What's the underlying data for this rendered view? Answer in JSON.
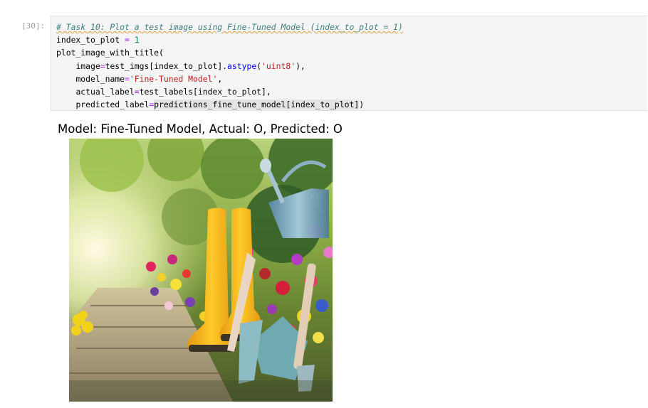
{
  "cell": {
    "prompt": "[30]:",
    "lines": {
      "l1": {
        "comment": "# Task 10: Plot a test image using Fine-Tuned Model (index_to_plot = 1)"
      },
      "l2": {
        "var": "index_to_plot",
        "op": " = ",
        "num": "1"
      },
      "l3": {
        "text": "plot_image_with_title("
      },
      "l4": {
        "indent": "    ",
        "kw": "image",
        "op": "=",
        "p1": "test_imgs[index_to_plot].",
        "meth": "astype",
        "p2": "(",
        "str": "'uint8'",
        "p3": "),"
      },
      "l5": {
        "indent": "    ",
        "kw": "model_name",
        "op": "=",
        "str": "'Fine-Tuned Model'",
        "p": ","
      },
      "l6": {
        "indent": "    ",
        "kw": "actual_label",
        "op": "=",
        "p": "test_labels[index_to_plot],"
      },
      "l7": {
        "indent": "    ",
        "kw": "predicted_label",
        "op": "=",
        "p1": "predictions_fine_tune_model[index_to_plot]",
        "p2": ")"
      }
    }
  },
  "output": {
    "title": "Model: Fine-Tuned Model, Actual: O, Predicted: O",
    "image_subject": "garden-boots-tools-flowers-photo"
  }
}
